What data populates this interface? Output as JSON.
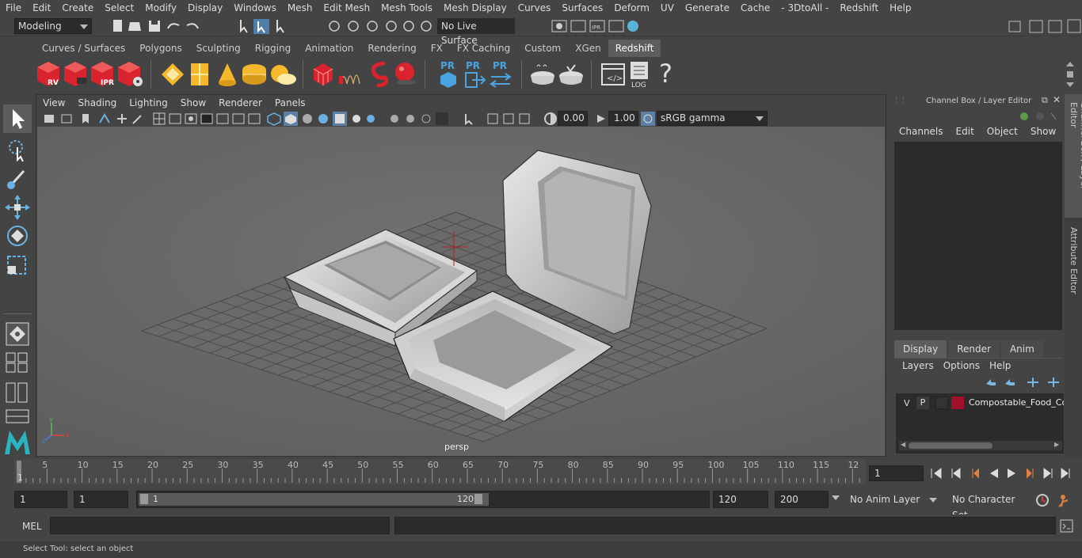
{
  "menubar": {
    "items": [
      "File",
      "Edit",
      "Create",
      "Select",
      "Modify",
      "Display",
      "Windows",
      "Mesh",
      "Edit Mesh",
      "Mesh Tools",
      "Mesh Display",
      "Curves",
      "Surfaces",
      "Deform",
      "UV",
      "Generate",
      "Cache",
      "- 3DtoAll -",
      "Redshift",
      "Help"
    ]
  },
  "statusline": {
    "mode": "Modeling",
    "live_surface": "No Live Surface"
  },
  "shelf": {
    "tabs": [
      "Curves / Surfaces",
      "Polygons",
      "Sculpting",
      "Rigging",
      "Animation",
      "Rendering",
      "FX",
      "FX Caching",
      "Custom",
      "XGen",
      "Redshift"
    ],
    "active_tab": "Redshift",
    "icon_labels": {
      "rv": "RV",
      "ipr": "IPR",
      "pr1": "PR",
      "pr2": "PR",
      "pr3": "PR",
      "log": "LOG",
      "help": "?"
    }
  },
  "viewport": {
    "menu": [
      "View",
      "Shading",
      "Lighting",
      "Show",
      "Renderer",
      "Panels"
    ],
    "exposure": "0.00",
    "gamma": "1.00",
    "colorspace": "sRGB gamma",
    "camera_label": "persp"
  },
  "channel_box": {
    "title": "Channel Box / Layer Editor",
    "menu": [
      "Channels",
      "Edit",
      "Object",
      "Show"
    ],
    "layer_tabs": [
      "Display",
      "Render",
      "Anim"
    ],
    "active_layer_tab": "Display",
    "layer_menu": [
      "Layers",
      "Options",
      "Help"
    ],
    "layer_row": {
      "v": "V",
      "p": "P",
      "name": "Compostable_Food_Co",
      "color": "#a0102a"
    }
  },
  "side_tabs": [
    "Channel Box / Layer Editor",
    "Attribute Editor"
  ],
  "timeline": {
    "ticks": [
      "5",
      "10",
      "15",
      "20",
      "25",
      "30",
      "35",
      "40",
      "45",
      "50",
      "55",
      "60",
      "65",
      "70",
      "75",
      "80",
      "85",
      "90",
      "95",
      "100",
      "105",
      "110",
      "115",
      "12"
    ],
    "start_label": "1",
    "current_frame": "1"
  },
  "range": {
    "start": "1",
    "playback_start": "1",
    "slider_start": "1",
    "slider_end": "120",
    "playback_end": "120",
    "end": "200",
    "anim_layer": "No Anim Layer",
    "character_set": "No Character Set"
  },
  "cmdline": {
    "label": "MEL"
  },
  "helpline": {
    "text": "Select Tool: select an object"
  }
}
